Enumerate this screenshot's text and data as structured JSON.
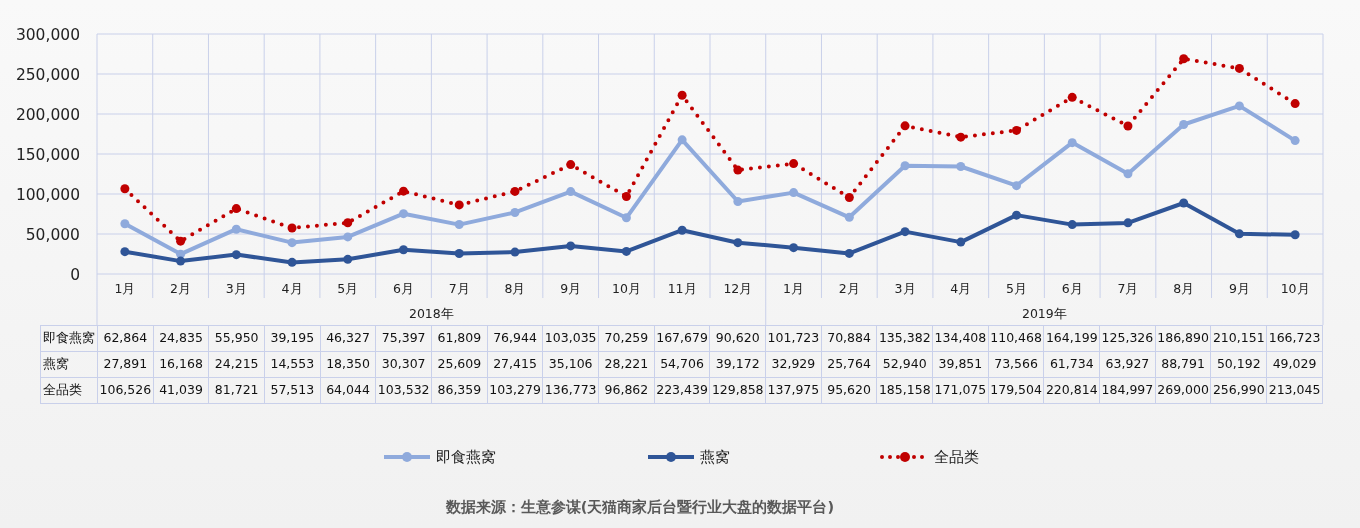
{
  "chart_data": {
    "type": "line",
    "categories": [
      "1月",
      "2月",
      "3月",
      "4月",
      "5月",
      "6月",
      "7月",
      "8月",
      "9月",
      "10月",
      "11月",
      "12月",
      "1月",
      "2月",
      "3月",
      "4月",
      "5月",
      "6月",
      "7月",
      "8月",
      "9月",
      "10月"
    ],
    "annotations": [
      "2018年",
      "2019年"
    ],
    "ylim": [
      0,
      300000
    ],
    "grid": true,
    "yticks": [
      {
        "value": 0,
        "label": "0"
      },
      {
        "value": 50000,
        "label": "50,000"
      },
      {
        "value": 100000,
        "label": "100,000"
      },
      {
        "value": 150000,
        "label": "150,000"
      },
      {
        "value": 200000,
        "label": "200,000"
      },
      {
        "value": 250000,
        "label": "250,000"
      },
      {
        "value": 300000,
        "label": "300,000"
      }
    ],
    "series": [
      {
        "name": "即食燕窝",
        "color": "#8faadc",
        "line_style": "solid",
        "marker": "circle",
        "values": [
          62864,
          24835,
          55950,
          39195,
          46327,
          75397,
          61809,
          76944,
          103035,
          70259,
          167679,
          90620,
          101723,
          70884,
          135382,
          134408,
          110468,
          164199,
          125326,
          186890,
          210151,
          166723
        ]
      },
      {
        "name": "燕窝",
        "color": "#2f5597",
        "line_style": "solid",
        "marker": "circle",
        "values": [
          27891,
          16168,
          24215,
          14553,
          18350,
          30307,
          25609,
          27415,
          35106,
          28221,
          54706,
          39172,
          32929,
          25764,
          52940,
          39851,
          73566,
          61734,
          63927,
          88791,
          50192,
          49029
        ]
      },
      {
        "name": "全品类",
        "color": "#c00000",
        "line_style": "dotted",
        "marker": "circle",
        "values": [
          106526,
          41039,
          81721,
          57513,
          64044,
          103532,
          86359,
          103279,
          136773,
          96862,
          223439,
          129858,
          137975,
          95620,
          185158,
          171075,
          179504,
          220814,
          184997,
          269000,
          256990,
          213045
        ]
      }
    ]
  },
  "data_table": {
    "rows": [
      {
        "label": "即食燕窝",
        "cells": [
          "62,864",
          "24,835",
          "55,950",
          "39,195",
          "46,327",
          "75,397",
          "61,809",
          "76,944",
          "103,035",
          "70,259",
          "167,679",
          "90,620",
          "101,723",
          "70,884",
          "135,382",
          "134,408",
          "110,468",
          "164,199",
          "125,326",
          "186,890",
          "210,151",
          "166,723"
        ]
      },
      {
        "label": "燕窝",
        "cells": [
          "27,891",
          "16,168",
          "24,215",
          "14,553",
          "18,350",
          "30,307",
          "25,609",
          "27,415",
          "35,106",
          "28,221",
          "54,706",
          "39,172",
          "32,929",
          "25,764",
          "52,940",
          "39,851",
          "73,566",
          "61,734",
          "63,927",
          "88,791",
          "50,192",
          "49,029"
        ]
      },
      {
        "label": "全品类",
        "cells": [
          "106,526",
          "41,039",
          "81,721",
          "57,513",
          "64,044",
          "103,532",
          "86,359",
          "103,279",
          "136,773",
          "96,862",
          "223,439",
          "129,858",
          "137,975",
          "95,620",
          "185,158",
          "171,075",
          "179,504",
          "220,814",
          "184,997",
          "269,000",
          "256,990",
          "213,045"
        ]
      }
    ]
  },
  "source_note": "数据来源：生意参谋(天猫商家后台暨行业大盘的数据平台)"
}
